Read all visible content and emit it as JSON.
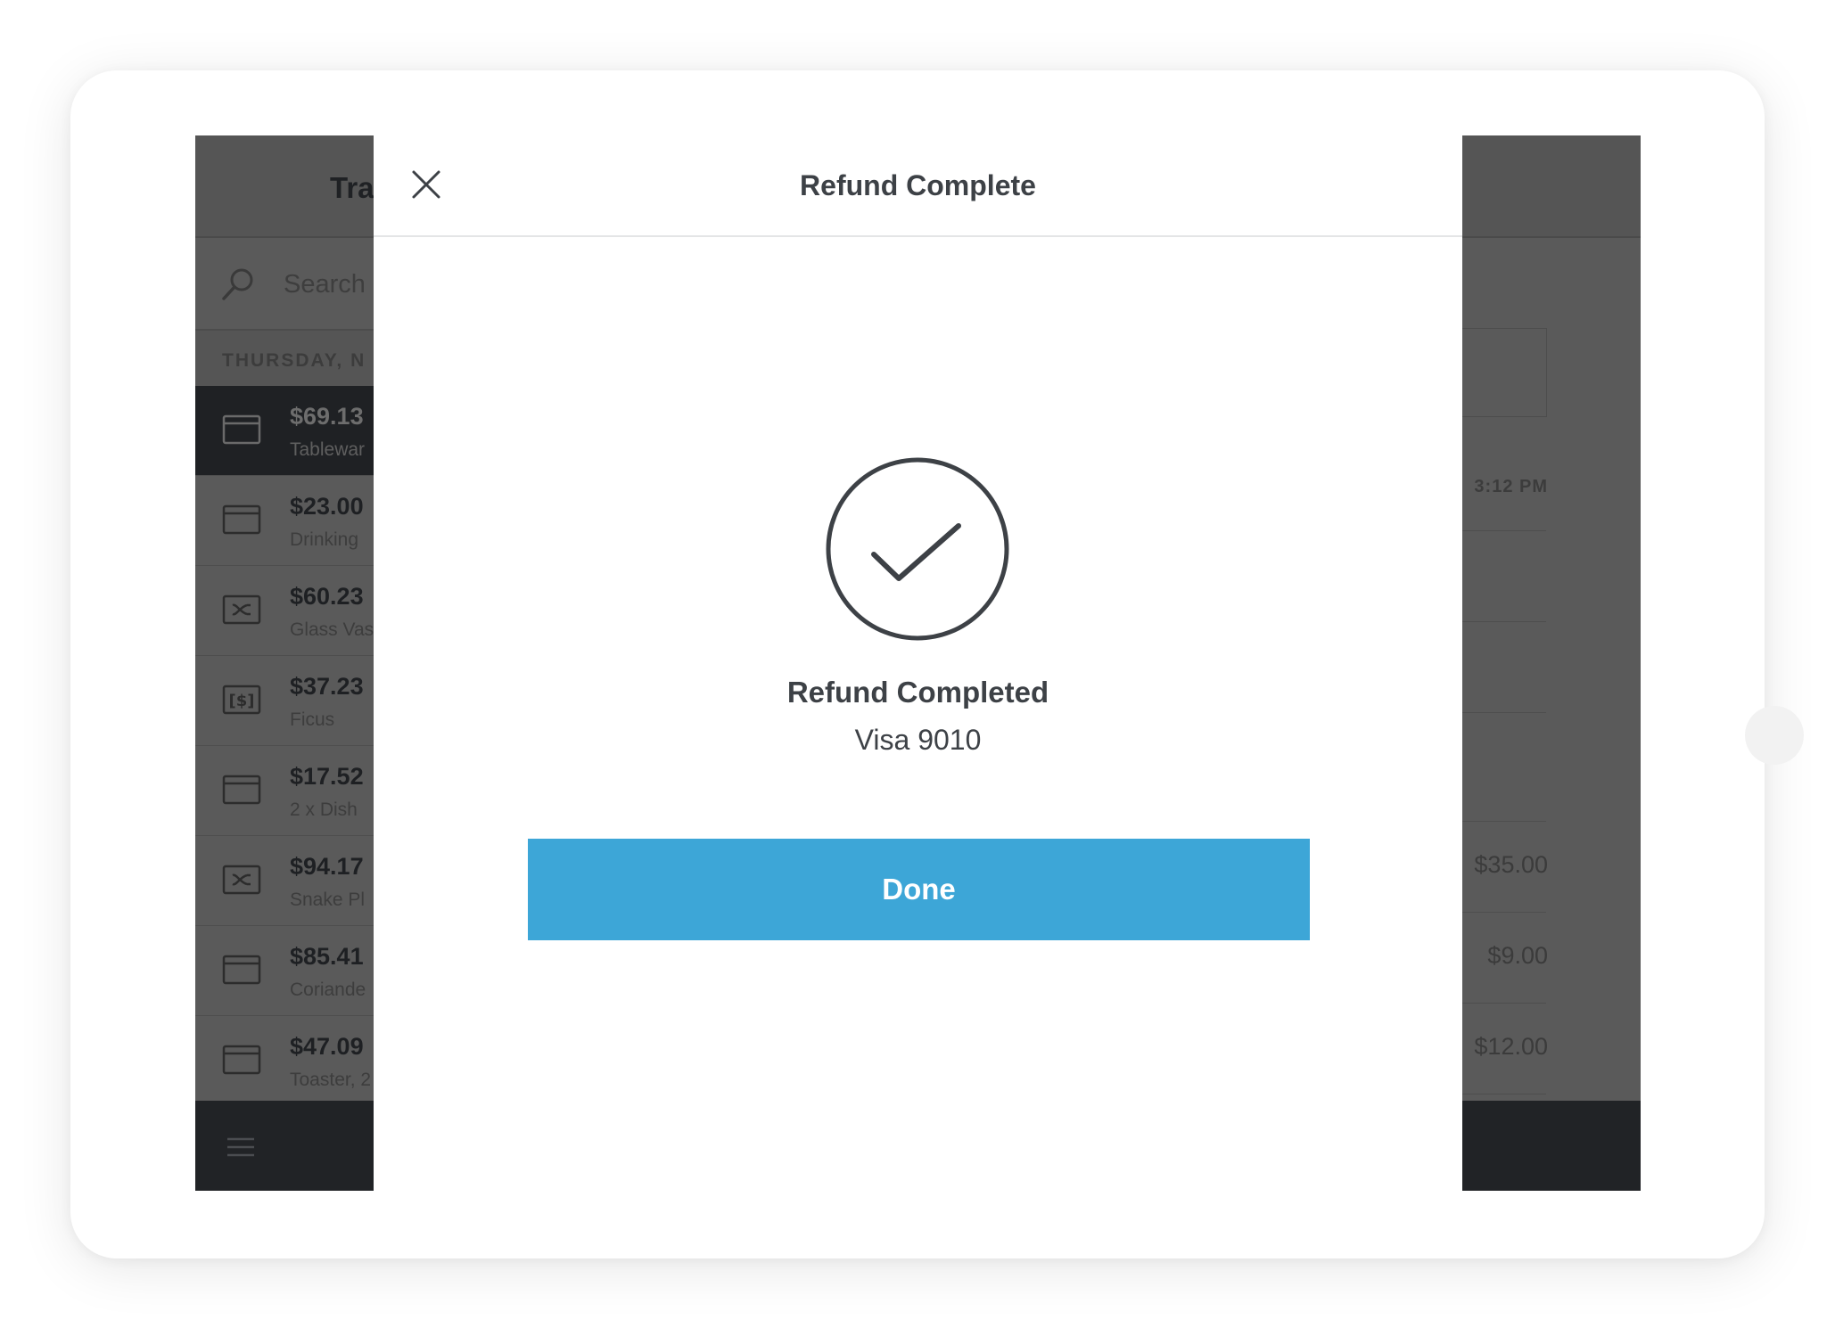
{
  "modal": {
    "title": "Refund Complete",
    "status_title": "Refund Completed",
    "status_subtitle": "Visa 9010",
    "done_label": "Done",
    "close_icon": "close-icon",
    "status_icon": "checkmark-circle-icon"
  },
  "left_panel": {
    "title": "Tra",
    "search_placeholder": "Search",
    "section_header": "THURSDAY, N",
    "transactions": [
      {
        "amount": "$69.13",
        "desc": "Tablewar",
        "icon": "card-icon",
        "selected": true
      },
      {
        "amount": "$23.00",
        "desc": "Drinking",
        "icon": "card-icon"
      },
      {
        "amount": "$60.23",
        "desc": "Glass Vas",
        "icon": "gift-card-icon"
      },
      {
        "amount": "$37.23",
        "desc": "Ficus",
        "icon": "cash-icon"
      },
      {
        "amount": "$17.52",
        "desc": "2 x Dish",
        "icon": "card-icon"
      },
      {
        "amount": "$94.17",
        "desc": "Snake Pl",
        "icon": "gift-card-icon"
      },
      {
        "amount": "$85.41",
        "desc": "Coriande",
        "icon": "card-icon"
      },
      {
        "amount": "$47.09",
        "desc": "Toaster, 2",
        "icon": "card-icon"
      }
    ],
    "menu_icon": "hamburger-menu-icon"
  },
  "right_panel": {
    "time": "3:12 PM",
    "prices": [
      "$35.00",
      "$9.00",
      "$12.00"
    ]
  },
  "colors": {
    "primary_button": "#3da6d7",
    "text_dark": "#3d4146",
    "overlay_dim": "#5a5a5a",
    "bottom_bar": "#212326"
  }
}
